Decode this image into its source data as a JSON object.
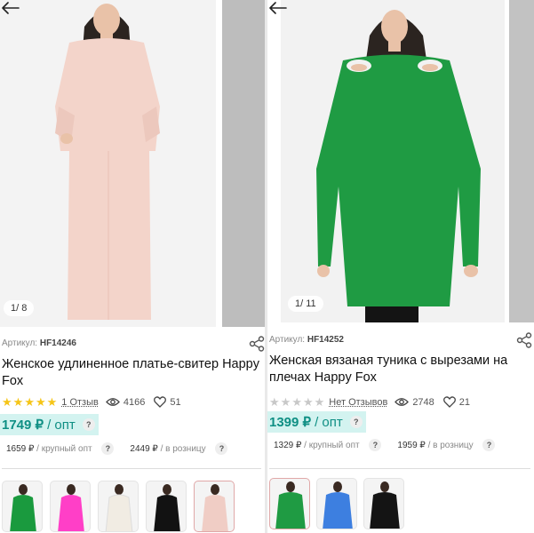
{
  "products": [
    {
      "photo_counter": "1/ 8",
      "article_label": "Артикул:",
      "article_value": "HF14246",
      "title": "Женское удлиненное платье-свитер Happy Fox",
      "stars_filled": 5,
      "reviews": "1 Отзыв",
      "views": "4166",
      "likes": "51",
      "price_main": "1749 ₽",
      "price_main_label": "/ опт",
      "price_large_value": "1659 ₽",
      "price_large_label": "/ крупный опт",
      "price_retail_value": "2449 ₽",
      "price_retail_label": "/ в розницу",
      "dress_color": "#f3d4ca",
      "thumb_colors": [
        "#1a9a3e",
        "#ff3fc7",
        "#f1ece3",
        "#121212",
        "#f0cdc5"
      ]
    },
    {
      "photo_counter": "1/ 11",
      "article_label": "Артикул:",
      "article_value": "HF14252",
      "title": "Женская вязаная туника с вырезами на плечах Happy Fox",
      "stars_filled": 0,
      "reviews": "Нет Отзывов",
      "views": "2748",
      "likes": "21",
      "price_main": "1399 ₽",
      "price_main_label": "/ опт",
      "price_large_value": "1329 ₽",
      "price_large_label": "/ крупный опт",
      "price_retail_value": "1959 ₽",
      "price_retail_label": "/ в розницу",
      "dress_color": "#1f9b43",
      "thumb_colors": [
        "#1f9b43",
        "#3d7fe0",
        "#141414"
      ]
    }
  ],
  "help_mark": "?",
  "colors": {
    "accent": "#0f8f84",
    "accent_bg": "#d3f3f0",
    "star": "#f5c518"
  }
}
